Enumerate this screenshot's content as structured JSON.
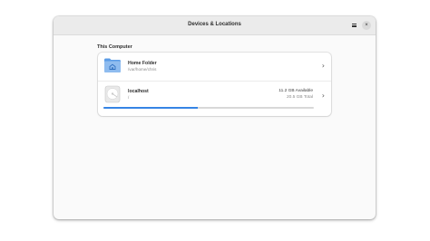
{
  "window": {
    "title": "Devices & Locations"
  },
  "header": {
    "close_glyph": "×",
    "menu_icon": "hamburger-menu-icon"
  },
  "section": {
    "title": "This Computer"
  },
  "locations": [
    {
      "name": "Home Folder",
      "subtitle": "/var/home/chris",
      "icon": "home-folder-icon"
    },
    {
      "name": "localhost",
      "subtitle": "/",
      "available": "11.2 GB Available",
      "total": "20.5 GB Total",
      "usage_fraction": 0.45,
      "icon": "drive-icon"
    }
  ],
  "chevron": "›",
  "colors": {
    "accent": "#3584e4",
    "folder": "#8fbcef"
  }
}
